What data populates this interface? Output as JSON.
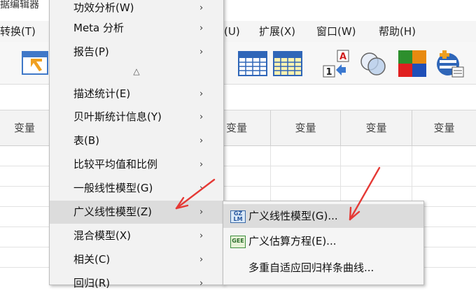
{
  "window": {
    "title_partial": "据编辑器"
  },
  "menubar": {
    "items": [
      {
        "label": "转换(T)"
      },
      {
        "label": "(U)"
      },
      {
        "label": "扩展(X)"
      },
      {
        "label": "窗口(W)"
      },
      {
        "label": "帮助(H)"
      }
    ]
  },
  "toolbar": {
    "icons": [
      "goto-case-icon",
      "data-grid-icon",
      "data-grid-yellow-icon",
      "value-labels-icon",
      "venn-circles-icon",
      "color-squares-icon",
      "spelling-stack-icon"
    ],
    "value_labels_icon": {
      "top_letter": "A",
      "bottom_number": "1"
    }
  },
  "grid": {
    "column_header": "变量"
  },
  "analyze_menu": {
    "scroll_indicator": "△",
    "items": [
      {
        "label": "功效分析(W)",
        "has_submenu": true
      },
      {
        "label": "Meta 分析",
        "has_submenu": true
      },
      {
        "label": "报告(P)",
        "has_submenu": true
      },
      {
        "label": "描述统计(E)",
        "has_submenu": true
      },
      {
        "label": "贝叶斯统计信息(Y)",
        "has_submenu": true
      },
      {
        "label": "表(B)",
        "has_submenu": true
      },
      {
        "label": "比较平均值和比例",
        "has_submenu": true
      },
      {
        "label": "一般线性模型(G)",
        "has_submenu": true
      },
      {
        "label": "广义线性模型(Z)",
        "has_submenu": true,
        "highlighted": true
      },
      {
        "label": "混合模型(X)",
        "has_submenu": true
      },
      {
        "label": "相关(C)",
        "has_submenu": true
      },
      {
        "label": "回归(R)",
        "has_submenu": true
      }
    ],
    "submenu_arrow": "›"
  },
  "glm_submenu": {
    "items": [
      {
        "label": "广义线性模型(G)...",
        "icon": "glm-icon",
        "icon_text": "GZ LM",
        "highlighted": true
      },
      {
        "label": "广义估算方程(E)...",
        "icon": "gee-icon",
        "icon_text": "GEE"
      },
      {
        "label": "多重自适应回归样条曲线..."
      }
    ]
  },
  "colors": {
    "highlight": "#dcdcdc",
    "annotation_arrow": "#e53935",
    "menu_bg": "#f2f2f2"
  }
}
